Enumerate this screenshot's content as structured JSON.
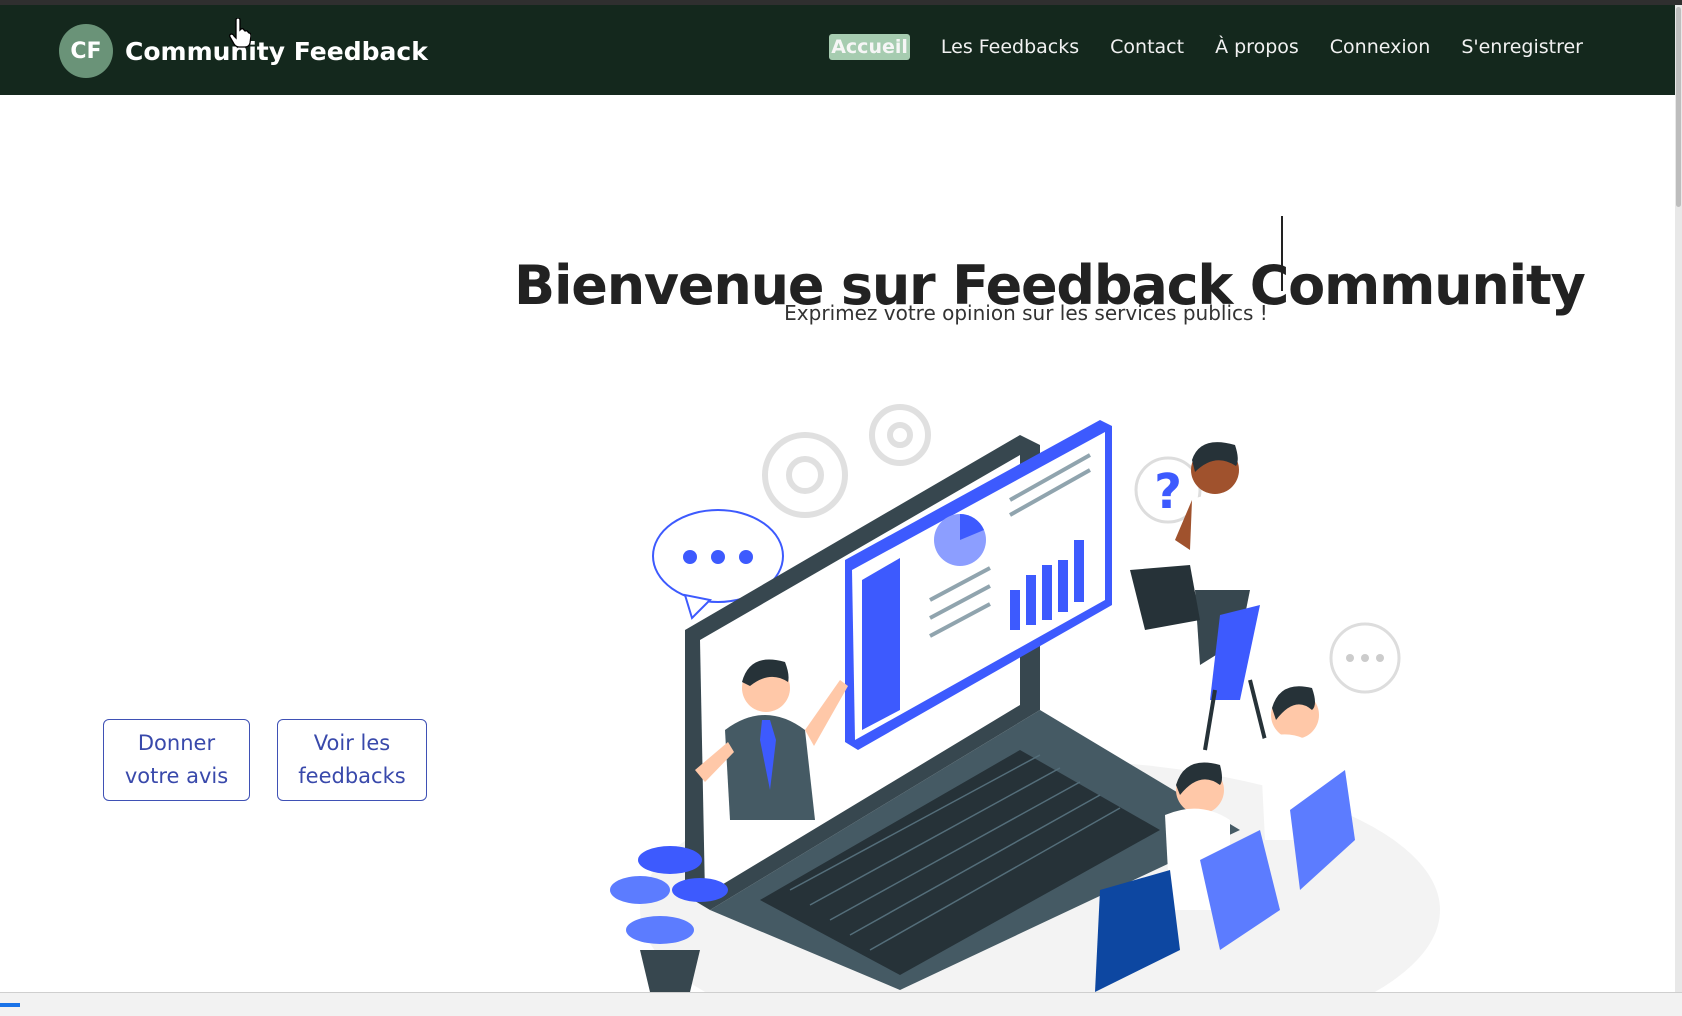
{
  "brand": {
    "logo_text": "CF",
    "name": "Community Feedback"
  },
  "nav": {
    "items": [
      {
        "label": "Accueil",
        "active": true
      },
      {
        "label": "Les Feedbacks"
      },
      {
        "label": "Contact"
      },
      {
        "label": "À propos"
      },
      {
        "label": "Connexion"
      },
      {
        "label": "S'enregistrer"
      }
    ]
  },
  "hero": {
    "title": "Bienvenue sur Feedback Community",
    "subtitle": "Exprimez votre opinion sur les services publics !"
  },
  "actions": {
    "give_feedback_line1": "Donner",
    "give_feedback_line2": "votre avis",
    "view_feedbacks_line1": "Voir les",
    "view_feedbacks_line2": "feedbacks"
  },
  "colors": {
    "navbar_bg": "#14281d",
    "logo_bg": "#6a9378",
    "active_nav_bg": "#a6ccb0",
    "button_border": "#3f51b5",
    "illustration_blue": "#3d5afe"
  }
}
